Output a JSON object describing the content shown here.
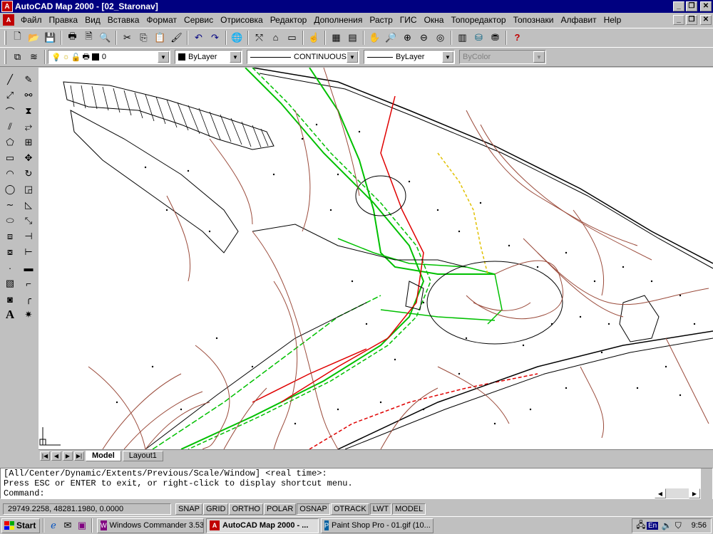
{
  "window": {
    "title": "AutoCAD Map 2000 - [02_Staronav]",
    "app_icon": "autocad-logo-icon",
    "buttons": [
      "_",
      "❐",
      "✕"
    ]
  },
  "menubar": {
    "items": [
      "Файл",
      "Правка",
      "Вид",
      "Вставка",
      "Формат",
      "Сервис",
      "Отрисовка",
      "Редактор",
      "Дополнения",
      "Растр",
      "ГИС",
      "Окна",
      "Топоредактор",
      "Топознаки",
      "Алфавит",
      "Help"
    ],
    "doc_buttons": [
      "_",
      "❐",
      "✕"
    ]
  },
  "standard_toolbar": {
    "icons": [
      "new-file-icon",
      "open-folder-icon",
      "save-icon",
      "print-icon",
      "print-preview-icon",
      "find-icon",
      "cut-icon",
      "copy-icon",
      "paste-icon",
      "match-properties-icon",
      "undo-icon",
      "redo-icon",
      "browser-globe-icon",
      "snap-from-icon",
      "ucs-icon",
      "distance-icon",
      "properties-icon",
      "design-center-icon",
      "layers-dialog-icon",
      "pan-icon",
      "zoom-realtime-icon",
      "zoom-window-icon",
      "zoom-previous-icon",
      "aerial-view-icon",
      "named-views-icon",
      "database-icon",
      "help-icon"
    ]
  },
  "properties_toolbar": {
    "layer_value": "0",
    "color_value": "ByLayer",
    "linetype_value": "CONTINUOUS",
    "lineweight_value": "ByLayer",
    "plotstyle_value": "ByColor"
  },
  "draw_palette": {
    "left": [
      "line-icon",
      "construction-line-icon",
      "polyline-icon",
      "multiline-icon",
      "polygon-icon",
      "rectangle-icon",
      "arc-icon",
      "circle-icon",
      "spline-icon",
      "ellipse-icon",
      "insert-block-icon",
      "make-block-icon",
      "point-icon",
      "hatch-icon",
      "region-icon",
      "text-icon"
    ],
    "right": [
      "erase-icon",
      "copy-object-icon",
      "mirror-icon",
      "offset-icon",
      "array-icon",
      "move-icon",
      "rotate-icon",
      "scale-icon",
      "stretch-icon",
      "lengthen-icon",
      "trim-icon",
      "extend-icon",
      "break-icon",
      "chamfer-icon",
      "fillet-icon",
      "explode-icon"
    ]
  },
  "layout_tabs": {
    "tabs": [
      "Model",
      "Layout1"
    ],
    "active": "Model"
  },
  "command_window": {
    "lines": [
      "[All/Center/Dynamic/Extents/Previous/Scale/Window] <real time>:",
      "Press ESC or ENTER to exit, or right-click to display shortcut menu.",
      "Command:"
    ]
  },
  "statusbar": {
    "coordinates": "29749.2258, 48281.1980, 0.0000",
    "toggles": [
      {
        "label": "SNAP",
        "on": false
      },
      {
        "label": "GRID",
        "on": false
      },
      {
        "label": "ORTHO",
        "on": false
      },
      {
        "label": "POLAR",
        "on": false
      },
      {
        "label": "OSNAP",
        "on": true
      },
      {
        "label": "OTRACK",
        "on": false
      },
      {
        "label": "LWT",
        "on": true
      },
      {
        "label": "MODEL",
        "on": true
      }
    ]
  },
  "taskbar": {
    "start_label": "Start",
    "quick_launch": [
      "internet-explorer-icon",
      "outlook-express-icon",
      "desktop-icon"
    ],
    "tasks": [
      {
        "label": "Windows Commander 3.53...",
        "active": false
      },
      {
        "label": "AutoCAD Map 2000 - ...",
        "active": true
      },
      {
        "label": "Paint Shop Pro - 01.gif (10...",
        "active": false
      }
    ],
    "language": "En",
    "clock": "9:56"
  },
  "colors": {
    "title_bar": "#000080",
    "contour_brown": "#9a4a3a",
    "road_green": "#00c000",
    "road_red": "#e00000",
    "boundary_black": "#000000"
  }
}
